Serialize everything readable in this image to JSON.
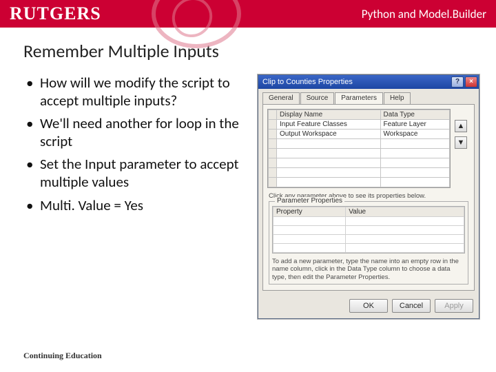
{
  "header": {
    "logo": "RUTGERS",
    "label": "Python and Model.Builder"
  },
  "slide": {
    "title": "Remember Multiple Inputs",
    "bullets": [
      "How will we modify the script to accept multiple inputs?",
      "We'll need another for loop in the script",
      "Set the Input parameter to accept multiple values",
      "Multi. Value = Yes"
    ],
    "footer": "Continuing Education"
  },
  "dialog": {
    "title": "Clip to Counties Properties",
    "tabs": [
      "General",
      "Source",
      "Parameters",
      "Help"
    ],
    "active_tab": "Parameters",
    "grid": {
      "columns": [
        "Display Name",
        "Data Type"
      ],
      "rows": [
        {
          "display_name": "Input Feature Classes",
          "data_type": "Feature Layer"
        },
        {
          "display_name": "Output Workspace",
          "data_type": "Workspace"
        }
      ],
      "blank_rows": 5
    },
    "hint": "Click any parameter above to see its properties below.",
    "param_props": {
      "legend": "Parameter Properties",
      "columns": [
        "Property",
        "Value"
      ],
      "blank_rows": 4,
      "note": "To add a new parameter, type the name into an empty row in the name column, click in the Data Type column to choose a data type, then edit the Parameter Properties."
    },
    "buttons": {
      "ok": "OK",
      "cancel": "Cancel",
      "apply": "Apply"
    }
  }
}
